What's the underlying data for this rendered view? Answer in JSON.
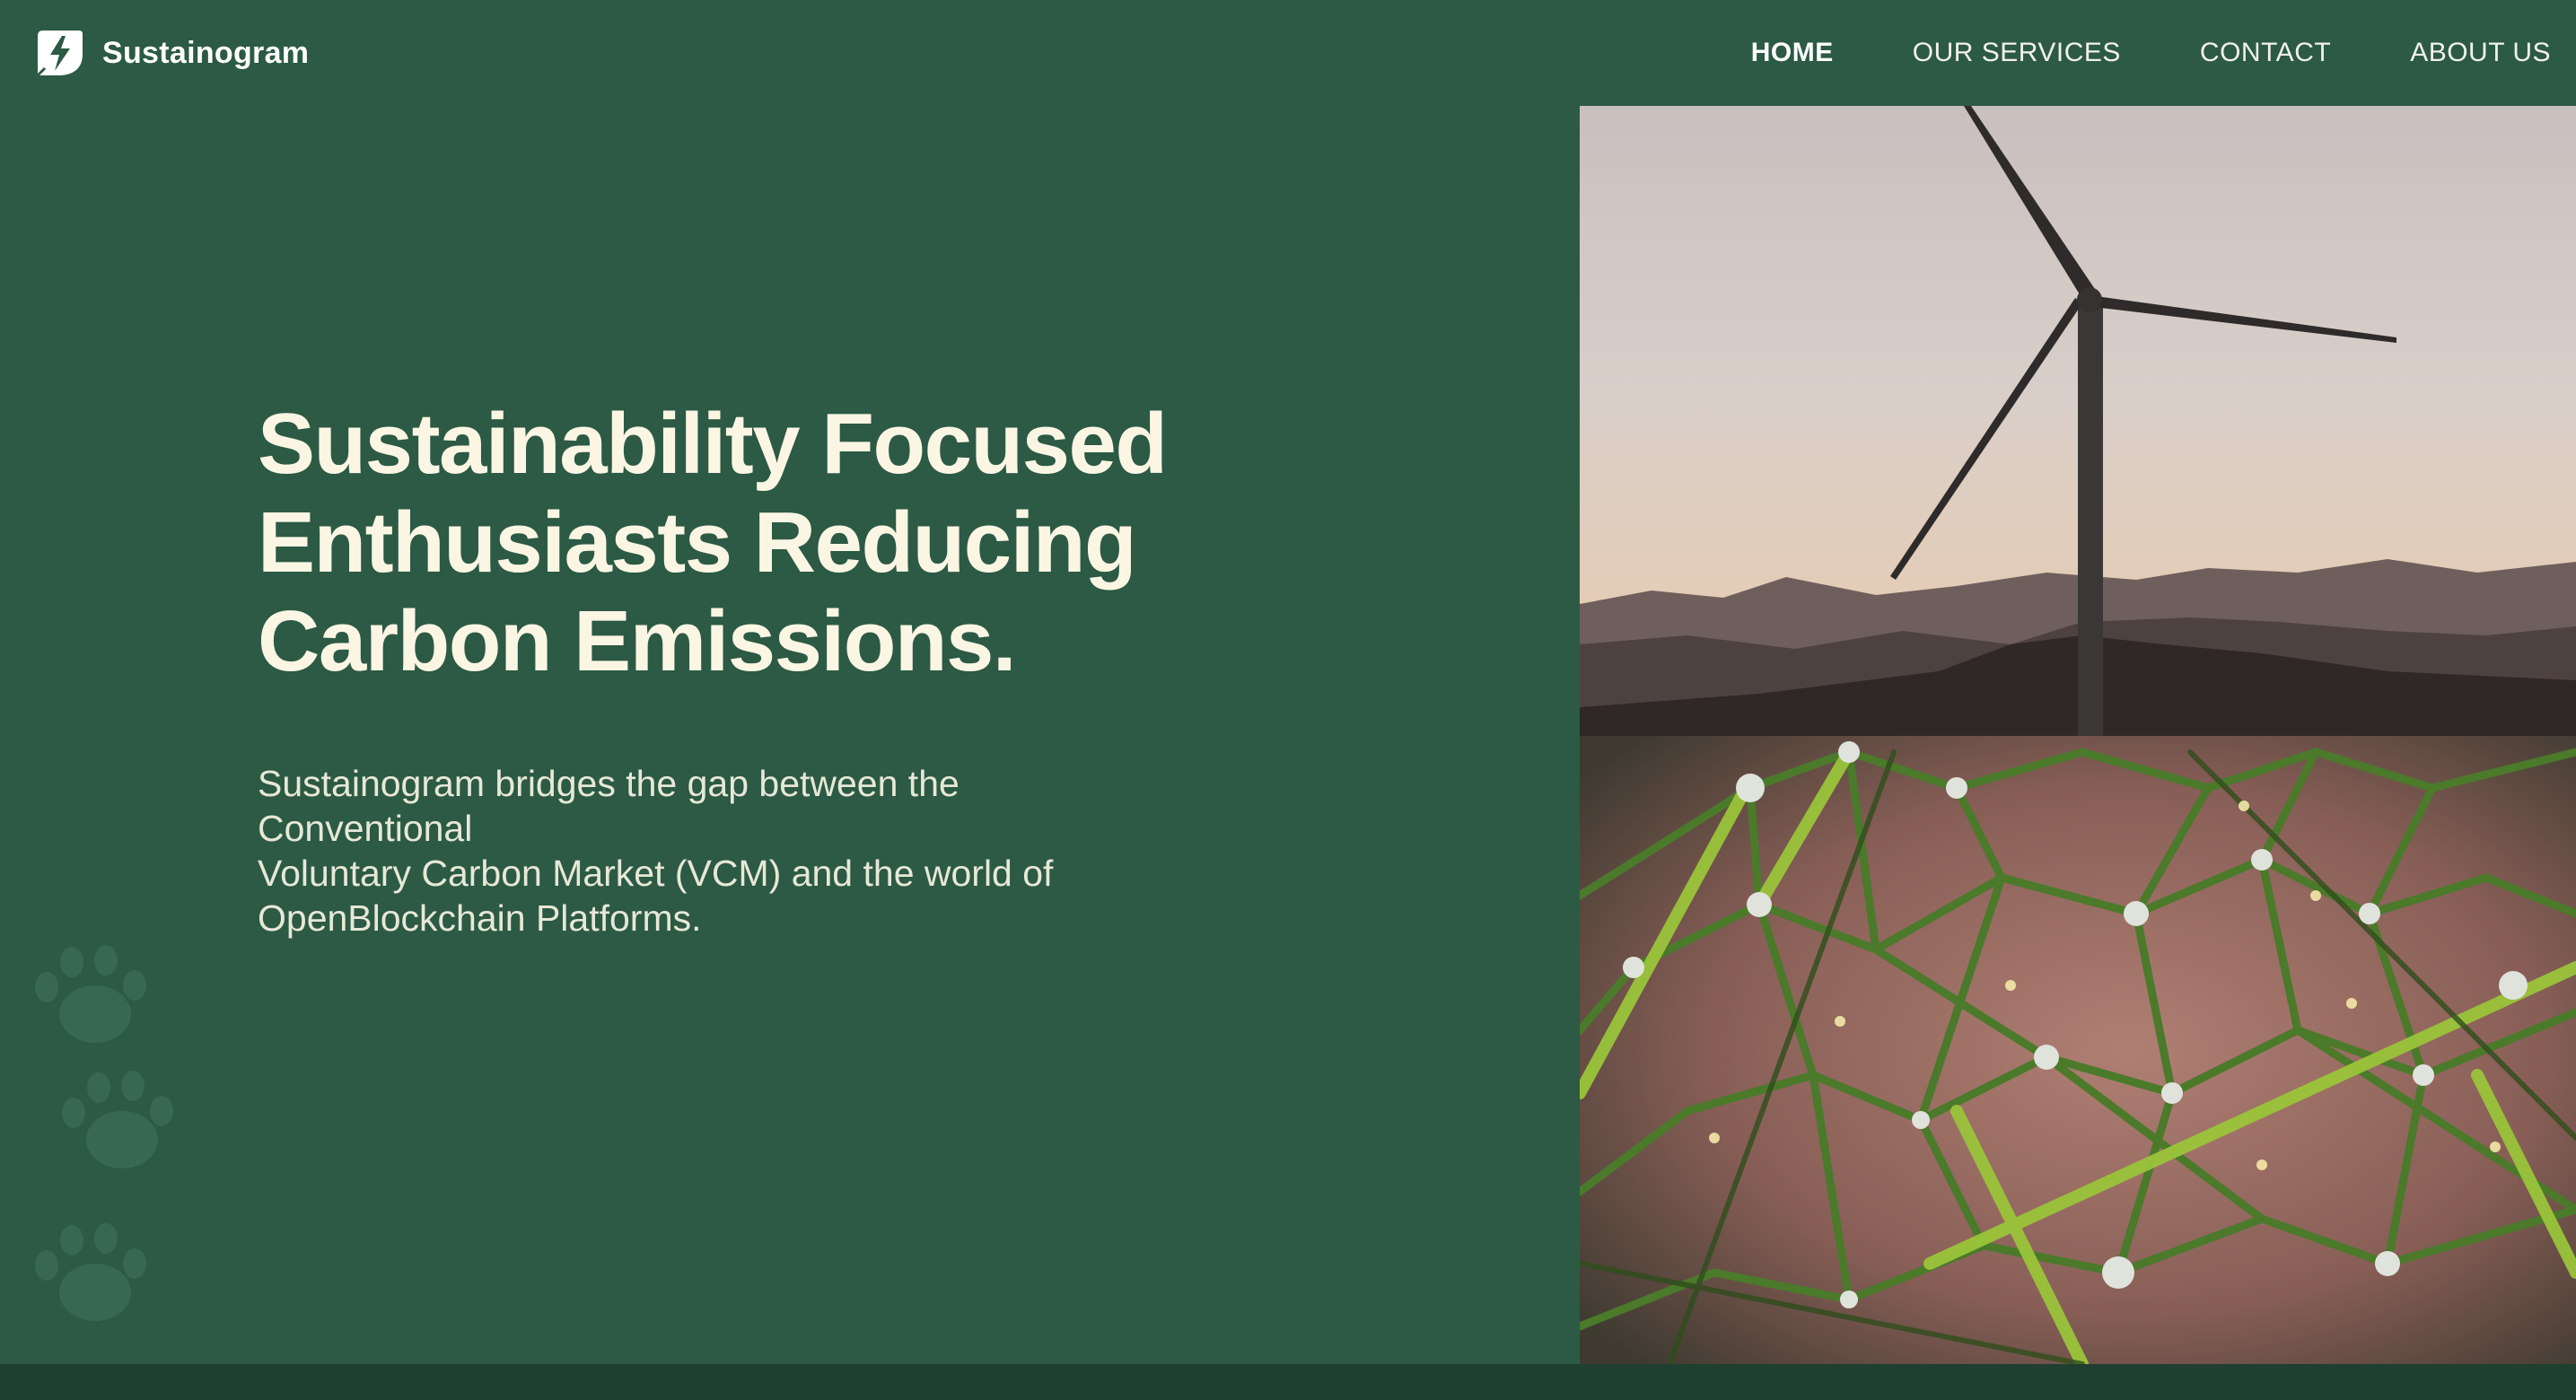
{
  "brand": {
    "name": "Sustainogram",
    "logo_icon": "leaf-bolt-logo-icon"
  },
  "nav": {
    "items": [
      {
        "label": "HOME",
        "active": true
      },
      {
        "label": "OUR SERVICES",
        "active": false
      },
      {
        "label": "CONTACT",
        "active": false
      },
      {
        "label": "ABOUT US",
        "active": false
      }
    ]
  },
  "hero": {
    "title_lines": [
      "Sustainability Focused",
      "Enthusiasts Reducing",
      "Carbon Emissions."
    ],
    "description_lines": [
      "Sustainogram bridges the gap between the",
      "Conventional",
      "Voluntary Carbon Market (VCM) and the world of",
      "OpenBlockchain Platforms."
    ]
  },
  "images": {
    "top": "wind-turbine-photo",
    "bottom": "green-rope-network-photo"
  },
  "decor": {
    "paw_icons": [
      "paw-print-icon",
      "paw-print-icon",
      "paw-print-icon"
    ]
  },
  "colors": {
    "background": "#2c5a44",
    "hero_text": "#fbf6e4",
    "footer": "#1f3f30"
  }
}
